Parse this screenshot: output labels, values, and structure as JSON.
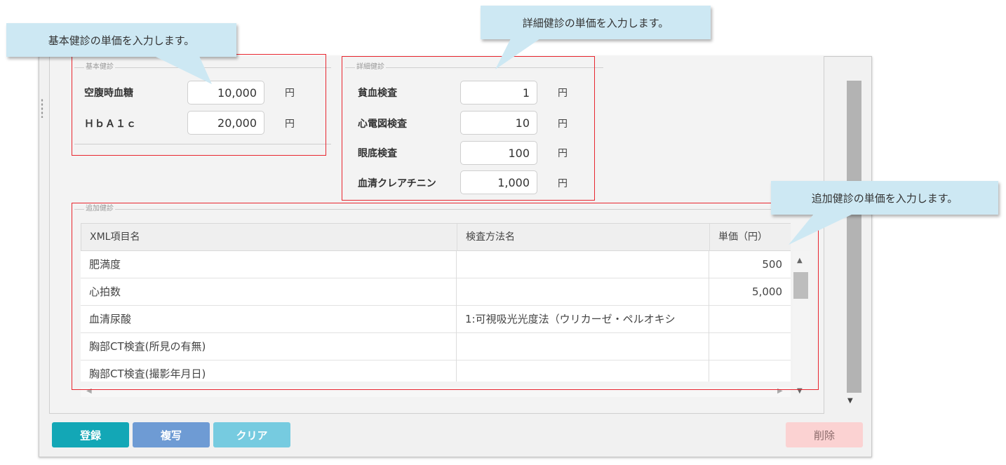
{
  "callouts": {
    "basic": "基本健診の単価を入力します。",
    "detail": "詳細健診の単価を入力します。",
    "additional": "追加健診の単価を入力します。"
  },
  "basic_section": {
    "legend": "基本健診",
    "fields": [
      {
        "label": "空腹時血糖",
        "value": "10,000",
        "unit": "円"
      },
      {
        "label": "ＨｂＡ１ｃ",
        "value": "20,000",
        "unit": "円"
      }
    ]
  },
  "detail_section": {
    "legend": "詳細健診",
    "fields": [
      {
        "label": "貧血検査",
        "value": "1",
        "unit": "円"
      },
      {
        "label": "心電図検査",
        "value": "10",
        "unit": "円"
      },
      {
        "label": "眼底検査",
        "value": "100",
        "unit": "円"
      },
      {
        "label": "血清クレアチニン",
        "value": "1,000",
        "unit": "円"
      }
    ]
  },
  "additional_section": {
    "legend": "追加健診",
    "columns": [
      "XML項目名",
      "検査方法名",
      "単価（円）"
    ],
    "rows": [
      {
        "item": "肥満度",
        "method": "",
        "price": "500"
      },
      {
        "item": "心拍数",
        "method": "",
        "price": "5,000"
      },
      {
        "item": "血清尿酸",
        "method": "1:可視吸光光度法（ウリカーゼ・ペルオキシ",
        "price": ""
      },
      {
        "item": "胸部CT検査(所見の有無)",
        "method": "",
        "price": ""
      },
      {
        "item": "胸部CT検査(撮影年月日)",
        "method": "",
        "price": ""
      }
    ]
  },
  "buttons": {
    "register": "登録",
    "copy": "複写",
    "clear": "クリア",
    "delete": "削除"
  },
  "colors": {
    "register": "#13a7b6",
    "copy": "#6e9bd4",
    "clear": "#76cbe0",
    "delete": "#fbd2d2",
    "highlight": "#e8262f",
    "callout": "#cde8f3"
  }
}
